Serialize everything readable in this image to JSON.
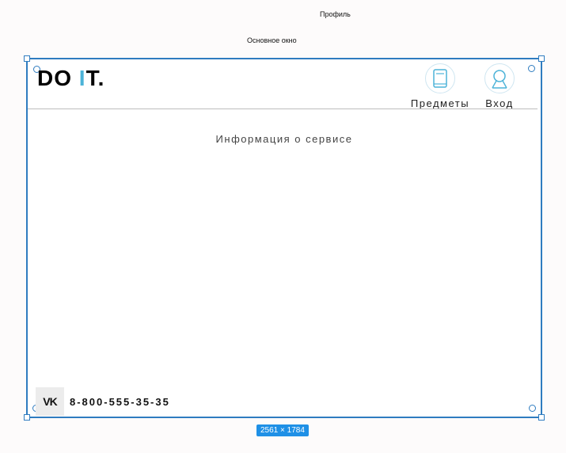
{
  "canvas": {
    "profile_label": "Профиль",
    "main_window_label": "Основное окно",
    "size_badge": "2561 × 1784",
    "frame_color": "#2f7cc0",
    "badge_color": "#1f90e6"
  },
  "header": {
    "logo_part1": "DO ",
    "logo_accent": "I",
    "logo_part2": "T.",
    "accent_color": "#4cb3d8",
    "nav": [
      {
        "label": "Предметы",
        "icon": "book-icon"
      },
      {
        "label": "Вход",
        "icon": "user-icon"
      }
    ]
  },
  "main": {
    "info_text": "Информация о сервисе"
  },
  "footer": {
    "social_label": "VK",
    "social_icon": "vk-icon",
    "phone": "8-800-555-35-35"
  }
}
